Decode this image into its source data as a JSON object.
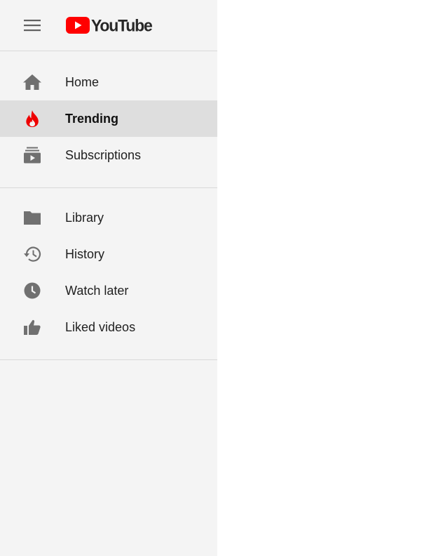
{
  "header": {
    "menu_icon": "hamburger-menu-icon",
    "logo_text": "YouTube",
    "logo_color": "#ff0000"
  },
  "primary_nav": [
    {
      "label": "Home",
      "icon": "home-icon",
      "active": false
    },
    {
      "label": "Trending",
      "icon": "fire-icon",
      "active": true
    },
    {
      "label": "Subscriptions",
      "icon": "subscriptions-icon",
      "active": false
    }
  ],
  "library_nav": [
    {
      "label": "Library",
      "icon": "folder-icon",
      "active": false
    },
    {
      "label": "History",
      "icon": "history-icon",
      "active": false
    },
    {
      "label": "Watch later",
      "icon": "clock-icon",
      "active": false
    },
    {
      "label": "Liked videos",
      "icon": "thumbs-up-icon",
      "active": false
    }
  ],
  "colors": {
    "drawer_bg": "#f4f4f4",
    "active_bg": "#dedede",
    "icon_gray": "#707070",
    "accent_red": "#ff0000"
  }
}
